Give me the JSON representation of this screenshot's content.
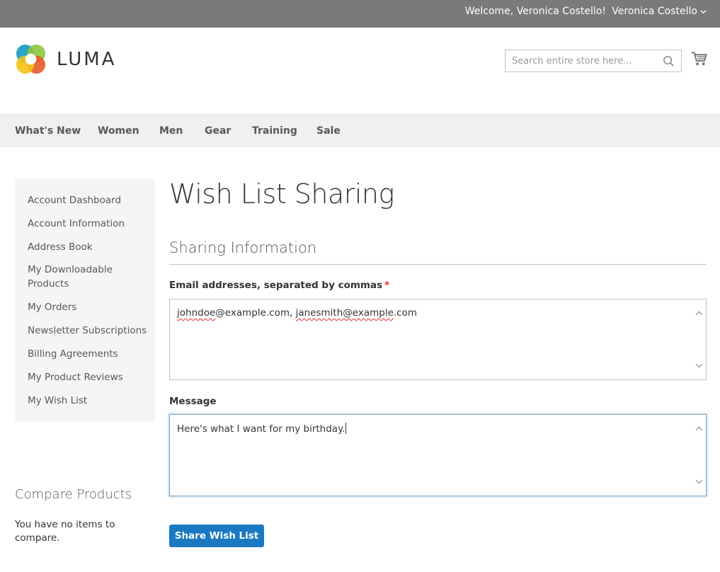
{
  "header": {
    "welcome": "Welcome, Veronica Costello!",
    "account_name": "Veronica Costello",
    "logo_text": "LUMA",
    "search_placeholder": "Search entire store here..."
  },
  "nav": {
    "items": [
      "What's New",
      "Women",
      "Men",
      "Gear",
      "Training",
      "Sale"
    ]
  },
  "sidebar": {
    "items": [
      "Account Dashboard",
      "Account Information",
      "Address Book",
      "My Downloadable Products",
      "My Orders",
      "Newsletter Subscriptions",
      "Billing Agreements",
      "My Product Reviews",
      "My Wish List"
    ]
  },
  "compare": {
    "title": "Compare Products",
    "empty_text": "You have no items to compare."
  },
  "main": {
    "page_title": "Wish List Sharing",
    "section_title": "Sharing Information",
    "email_label": "Email addresses, separated by commas",
    "required_mark": "*",
    "email_value": {
      "part1": "johndoe",
      "part2": "@example.com, ",
      "part3": "janesmith@example",
      "part4": ".com"
    },
    "message_label": "Message",
    "message_value": "Here's what I want for my birthday.",
    "submit_label": "Share Wish List"
  },
  "colors": {
    "topbar": "#7a7a78",
    "primary": "#1979c3",
    "required": "#e02b27"
  },
  "icons": [
    "chevron-down-icon",
    "luma-logo-icon",
    "search-icon",
    "cart-icon",
    "scroll-up-icon",
    "scroll-down-icon"
  ]
}
